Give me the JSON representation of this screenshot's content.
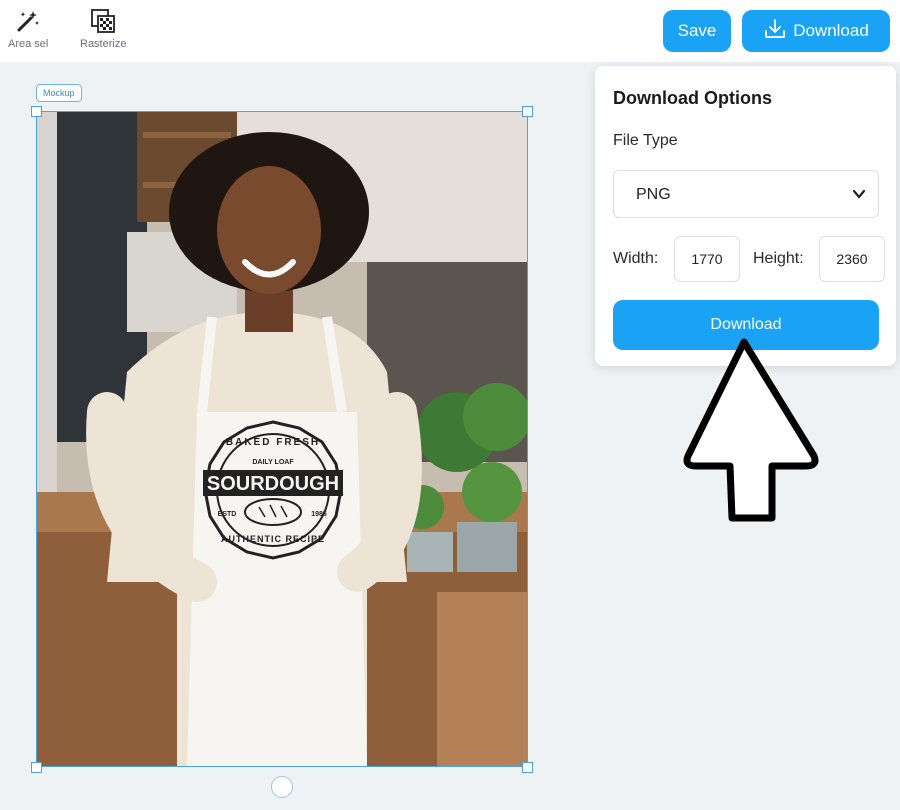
{
  "toolbar": {
    "area_select_label": "Area sel",
    "area_select_icon": "magic-wand-icon",
    "rasterize_label": "Rasterize",
    "rasterize_icon": "rasterize-grid-icon",
    "save_label": "Save",
    "download_label": "Download",
    "download_icon": "download-tray-icon"
  },
  "canvas": {
    "mockup_tag": "Mockup",
    "mockup_image": {
      "description_icon": "mockup-photo",
      "apron_logo": {
        "top_text": "BAKED FRESH",
        "sub_text": "DAILY LOAF",
        "main_text": "SOURDOUGH",
        "estd_label": "ESTD",
        "year": "1985",
        "bottom_text": "AUTHENTIC RECIPE"
      }
    }
  },
  "download_panel": {
    "title": "Download Options",
    "file_type_label": "File Type",
    "file_type_value": "PNG",
    "width_label": "Width:",
    "width_value": "1770",
    "height_label": "Height:",
    "height_value": "2360",
    "download_button_label": "Download"
  },
  "colors": {
    "accent": "#1aa3f5",
    "selection": "#4aa3e0",
    "canvas_bg": "#eef2f4"
  }
}
